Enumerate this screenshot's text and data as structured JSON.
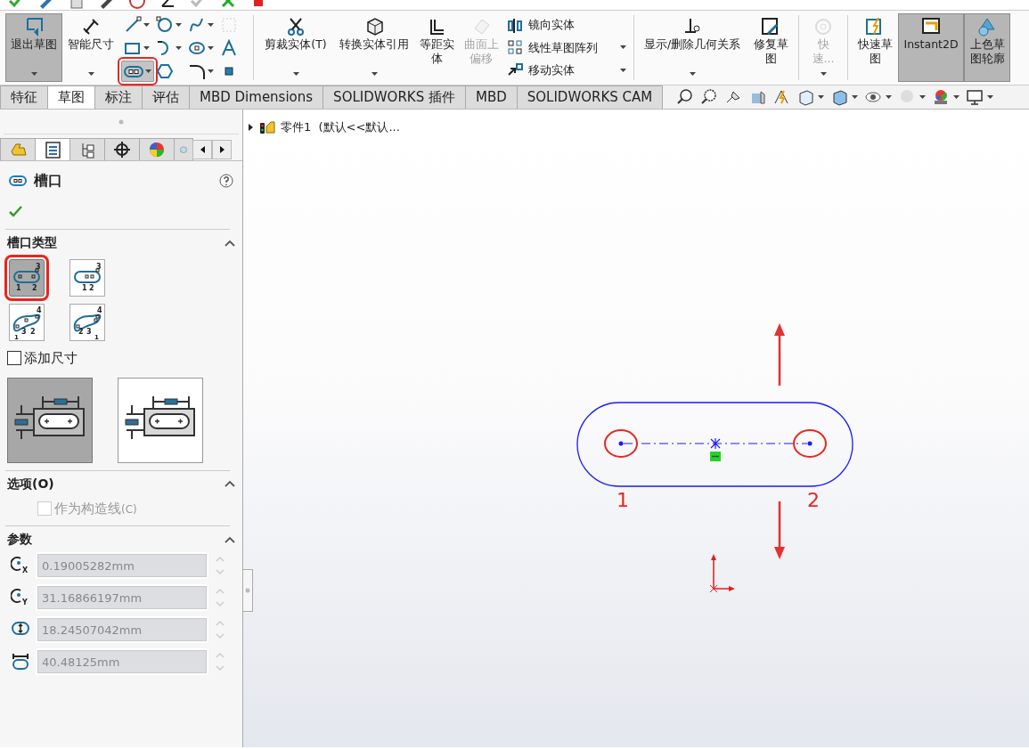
{
  "ribbon": [
    {
      "kind": "button",
      "label": "退出草图",
      "selected": true,
      "disabled": false,
      "dropdown": true,
      "separator_after": false
    },
    {
      "kind": "button",
      "label": "智能尺寸",
      "selected": false,
      "disabled": false,
      "dropdown": true,
      "separator_after": false
    },
    {
      "kind": "tool_grid",
      "separator_after": true,
      "tools": [
        {
          "selected": false,
          "highlighted": false,
          "dropdown": true
        },
        {
          "selected": false,
          "highlighted": false,
          "dropdown": true
        },
        {
          "selected": false,
          "highlighted": false,
          "dropdown": true
        },
        {
          "selected": false,
          "highlighted": false,
          "dropdown": false
        },
        {
          "selected": false,
          "highlighted": false,
          "dropdown": true
        },
        {
          "selected": false,
          "highlighted": false,
          "dropdown": true
        },
        {
          "selected": false,
          "highlighted": false,
          "dropdown": true
        },
        {
          "selected": false,
          "highlighted": false,
          "dropdown": false
        },
        {
          "selected": true,
          "highlighted": true,
          "dropdown": true
        },
        {
          "selected": false,
          "highlighted": false,
          "dropdown": false
        },
        {
          "selected": false,
          "highlighted": false,
          "dropdown": true
        },
        {
          "selected": false,
          "highlighted": false,
          "dropdown": false
        }
      ]
    },
    {
      "kind": "button",
      "label": "剪裁实体(T)",
      "selected": false,
      "disabled": false,
      "dropdown": true,
      "separator_after": false
    },
    {
      "kind": "button",
      "label": "转换实体引用",
      "selected": false,
      "disabled": false,
      "dropdown": true,
      "separator_after": false
    },
    {
      "kind": "button",
      "label": "等距实体",
      "selected": false,
      "disabled": false,
      "dropdown": false,
      "separator_after": false
    },
    {
      "kind": "button",
      "label": "曲面上偏移",
      "selected": false,
      "disabled": true,
      "dropdown": false,
      "separator_after": false
    },
    {
      "kind": "stack",
      "separator_after": true,
      "items": [
        {
          "label": "镜向实体",
          "dropdown": false
        },
        {
          "label": "线性草图阵列",
          "dropdown": true
        },
        {
          "label": "移动实体",
          "dropdown": true
        }
      ]
    },
    {
      "kind": "button",
      "label": "显示/删除几何关系",
      "selected": false,
      "disabled": false,
      "dropdown": true,
      "separator_after": false
    },
    {
      "kind": "button",
      "label": "修复草图",
      "selected": false,
      "disabled": false,
      "dropdown": false,
      "separator_after": true
    },
    {
      "kind": "button",
      "label": "快速...",
      "selected": false,
      "disabled": true,
      "dropdown": true,
      "separator_after": true
    },
    {
      "kind": "button",
      "label": "快速草图",
      "selected": false,
      "disabled": false,
      "dropdown": false,
      "separator_after": false
    },
    {
      "kind": "button",
      "label": "Instant2D",
      "selected": true,
      "disabled": false,
      "dropdown": false,
      "separator_after": false
    },
    {
      "kind": "button",
      "label": "上色草图轮廓",
      "selected": true,
      "disabled": false,
      "dropdown": false,
      "separator_after": false
    }
  ],
  "command_tabs": [
    {
      "label": "特征",
      "selected": false
    },
    {
      "label": "草图",
      "selected": true
    },
    {
      "label": "标注",
      "selected": false
    },
    {
      "label": "评估",
      "selected": false
    },
    {
      "label": "MBD Dimensions",
      "selected": false
    },
    {
      "label": "SOLIDWORKS 插件",
      "selected": false
    },
    {
      "label": "MBD",
      "selected": false
    },
    {
      "label": "SOLIDWORKS CAM",
      "selected": false
    }
  ],
  "property_manager": {
    "panel_tabs": [
      {
        "selected": false
      },
      {
        "selected": true
      },
      {
        "selected": false
      },
      {
        "selected": false
      },
      {
        "selected": false
      },
      {
        "selected": false
      }
    ],
    "title": "槽口",
    "slot_type": {
      "title": "槽口类型",
      "expanded": true,
      "types": [
        {
          "selected": true,
          "highlighted": true,
          "labels": [
            "3",
            "1",
            "2"
          ]
        },
        {
          "selected": false,
          "highlighted": false,
          "labels": [
            "3",
            "1",
            "2"
          ]
        },
        {
          "selected": false,
          "highlighted": false,
          "labels": [
            "4",
            "3",
            "2",
            "1"
          ]
        },
        {
          "selected": false,
          "highlighted": false,
          "labels": [
            "4",
            "2",
            "3",
            "1"
          ]
        }
      ]
    },
    "add_dimensions": {
      "label": "添加尺寸",
      "checked": false
    },
    "dimension_styles": [
      {
        "selected": true
      },
      {
        "selected": false
      }
    ],
    "options": {
      "title": "选项(O)",
      "expanded": true,
      "construction": {
        "label": "作为构造线",
        "shortcut": "(C)",
        "checked": false,
        "disabled": true
      }
    },
    "parameters": {
      "title": "参数",
      "expanded": true,
      "fields": [
        {
          "value": "0.19005282mm",
          "axis": "X",
          "disabled": true
        },
        {
          "value": "31.16866197mm",
          "axis": "Y",
          "disabled": true
        },
        {
          "value": "18.24507042mm",
          "disabled": true
        },
        {
          "value": "40.48125mm",
          "disabled": true
        }
      ]
    }
  },
  "canvas": {
    "tree": {
      "label": "零件1  (默认<<默认...",
      "expanded": false
    },
    "sketch": {
      "kind": "slot",
      "markers": [
        {
          "label": "1"
        },
        {
          "label": "2"
        }
      ]
    }
  }
}
